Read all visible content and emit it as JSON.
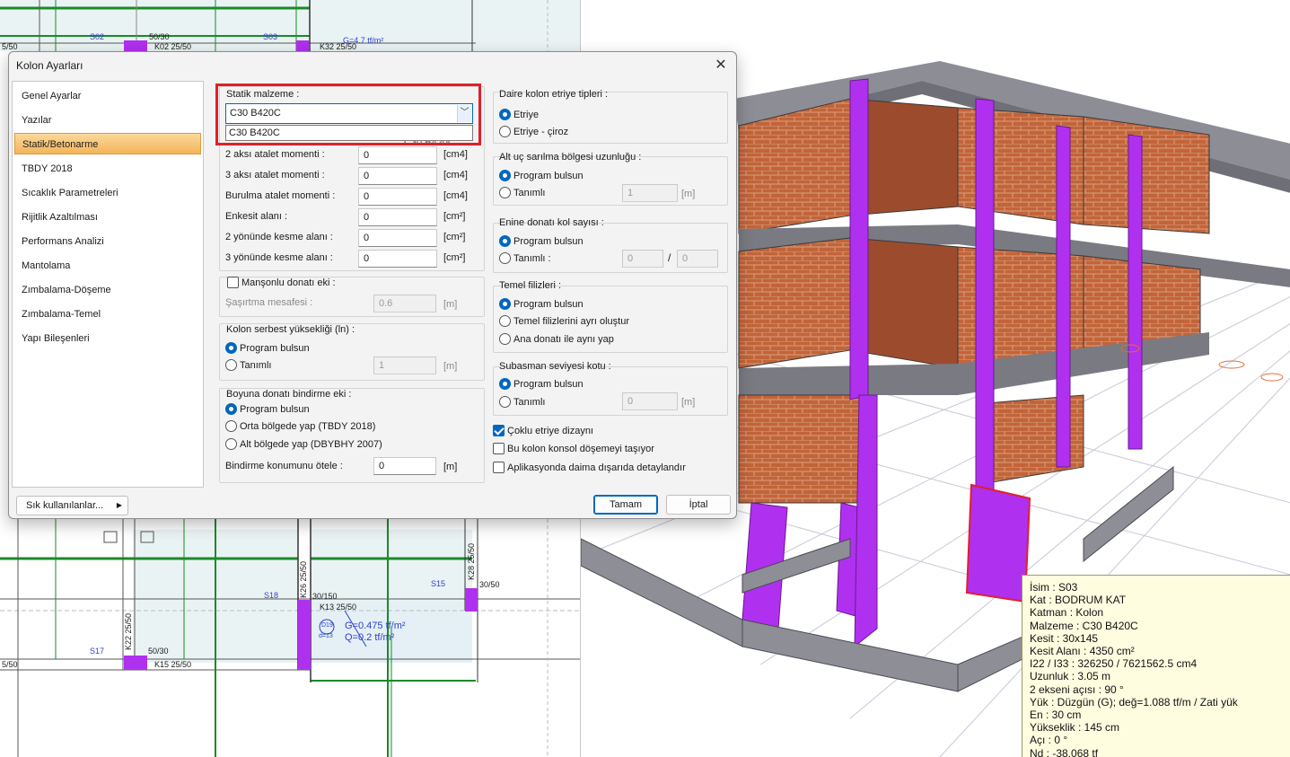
{
  "dialog": {
    "title": "Kolon Ayarları",
    "close_glyph": "✕",
    "nav": [
      {
        "label": "Genel Ayarlar"
      },
      {
        "label": "Yazılar"
      },
      {
        "label": "Statik/Betonarme",
        "active": true
      },
      {
        "label": "TBDY 2018"
      },
      {
        "label": "Sıcaklık Parametreleri"
      },
      {
        "label": "Rijitlik Azaltılması"
      },
      {
        "label": "Performans Analizi"
      },
      {
        "label": "Mantolama"
      },
      {
        "label": "Zımbalama-Döşeme"
      },
      {
        "label": "Zımbalama-Temel"
      },
      {
        "label": "Yapı Bileşenleri"
      }
    ],
    "material": {
      "title": "Statik malzeme :",
      "value": "C30 B420C",
      "dropdown_option": "C30 B420C",
      "behind_text": "C30 B420C"
    },
    "properties": [
      {
        "label": "2 aksı atalet momenti :",
        "value": "0",
        "unit": "[cm4]"
      },
      {
        "label": "3 aksı atalet momenti :",
        "value": "0",
        "unit": "[cm4]"
      },
      {
        "label": "Burulma atalet momenti :",
        "value": "0",
        "unit": "[cm4]"
      },
      {
        "label": "Enkesit alanı :",
        "value": "0",
        "unit": "[cm²]"
      },
      {
        "label": "2 yönünde kesme alanı :",
        "value": "0",
        "unit": "[cm²]"
      },
      {
        "label": "3 yönünde kesme alanı :",
        "value": "0",
        "unit": "[cm²]"
      }
    ],
    "manson": {
      "check_label": "Manşonlu donatı eki :",
      "checked": false,
      "offset_label": "Şaşırtma mesafesi :",
      "offset_value": "0.6",
      "unit": "[m]"
    },
    "serbest": {
      "title": "Kolon serbest yüksekliği (ln) :",
      "option1": "Program bulsun",
      "option2": "Tanımlı",
      "value": "1",
      "unit": "[m]"
    },
    "bindirme": {
      "title": "Boyuna donatı bindirme eki :",
      "option1": "Program bulsun",
      "option2": "Orta bölgede yap (TBDY 2018)",
      "option3": "Alt bölgede yap (DBYBHY 2007)",
      "shift_label": "Bindirme konumunu ötele :",
      "shift_value": "0",
      "unit": "[m]"
    },
    "daire": {
      "title": "Daire kolon etriye tipleri :",
      "option1": "Etriye",
      "option2": "Etriye - çiroz"
    },
    "altuc": {
      "title": "Alt uç sarılma bölgesi uzunluğu :",
      "option1": "Program bulsun",
      "option2": "Tanımlı",
      "value": "1",
      "unit": "[m]"
    },
    "enine": {
      "title": "Enine donatı kol sayısı :",
      "option1": "Program bulsun",
      "option2": "Tanımlı :",
      "value1": "0",
      "separator": "/",
      "value2": "0"
    },
    "temel": {
      "title": "Temel filizleri :",
      "option1": "Program bulsun",
      "option2": "Temel filizlerini ayrı oluştur",
      "option3": "Ana donatı ile aynı yap"
    },
    "subasman": {
      "title": "Subasman seviyesi kotu  :",
      "option1": "Program bulsun",
      "option2": "Tanımlı",
      "value": "0",
      "unit": "[m]"
    },
    "checks": [
      {
        "label": "Çoklu etriye dizaynı",
        "checked": true
      },
      {
        "label": "Bu kolon konsol döşemeyi taşıyor",
        "checked": false
      },
      {
        "label": "Aplikasyonda daima dışarıda detaylandır",
        "checked": false
      }
    ],
    "buttons": {
      "frequent": "Sık kullanılanlar...",
      "frequent_arrow": "▶",
      "ok": "Tamam",
      "cancel": "İptal"
    }
  },
  "plan": {
    "labels": {
      "s02": "S02",
      "s03": "S03",
      "k02": "K02  25/50",
      "k32": "K32  25/50",
      "col5030": "50/30",
      "top_left": "5/50",
      "load_top": "G=4.7 tf/m²",
      "s18": "S18",
      "s15": "S15",
      "s17": "S17",
      "k13": "K13  25/50",
      "k15": "K15  25/50",
      "k26": "K26  25/50",
      "k28": "K28  25/50",
      "k22": "K22  25/50",
      "col30150": "30/150",
      "col3050": "30/50",
      "col5030b": "50/30",
      "bottom_left": "5/50",
      "load_g": "G=0.475 tf/m²",
      "load_q": "Q=0.2 tf/m²",
      "d19": "D19",
      "d13": "d=13"
    }
  },
  "info": {
    "lines": [
      "İsim : S03",
      "Kat : BODRUM KAT",
      "Katman : Kolon",
      "Malzeme : C30 B420C",
      "Kesit : 30x145",
      "Kesit Alanı : 4350 cm²",
      "I22 / I33 : 326250  /  7621562.5 cm4",
      "Uzunluk : 3.05 m",
      "2 ekseni açısı : 90 °",
      "Yük : Düzgün (G); değ=1.088 tf/m  /  Zati yük",
      "En : 30 cm",
      "Yükseklik : 145 cm",
      "Açı : 0 °",
      "Nd : -38.068 tf"
    ]
  },
  "colors": {
    "accent": "#0067c0",
    "highlight": "#e0202a",
    "column_purple": "#b030f0",
    "brick": "#c2643a",
    "beam_green": "#1a8a2a"
  }
}
